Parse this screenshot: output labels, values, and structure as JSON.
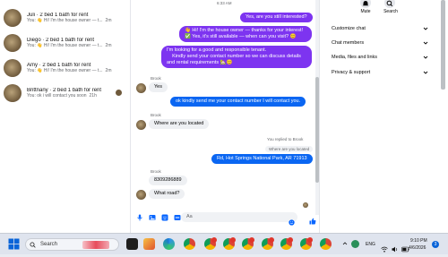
{
  "colors": {
    "purple": "#7d34f0",
    "blue": "#0a66f2",
    "accent": "#0866ff"
  },
  "chat_list": [
    {
      "name": "Juli · 2 bed 1 bath for rent",
      "preview": "You: 👋 Hi! I'm the house owner — t...",
      "time": "2m"
    },
    {
      "name": "Diego · 2 bed 1 bath for rent",
      "preview": "You: 👋 Hi! I'm the house owner — t...",
      "time": "2m"
    },
    {
      "name": "Amy · 2 bed 1 bath for rent",
      "preview": "You: 👋 Hi! I'm the house owner — t...",
      "time": "2m"
    },
    {
      "name": "Brittnany · 2 bed 1 bath for rent",
      "preview": "You: ok i will contact you soon",
      "time": "21h"
    }
  ],
  "conversation": {
    "timestamp": "6:33 AM",
    "msg1": "Yes, are you still interested?",
    "msg2a": "👋 Hi! I'm the house owner — thanks for your interest!",
    "msg2b": "✅ Yes, it's still available — when can you visit? 😊",
    "msg3a": "I'm looking for a good and responsible tenant.",
    "msg3b": "Kindly send your contact number so we can discuss details",
    "msg3c": "and rental requirements 🏡😊",
    "sender1": "Brook",
    "in1": "Yes",
    "out_blue1": "ok kindly send me your contact number I will contact you.",
    "sender2": "Brook",
    "in2": "Where are you located",
    "replied_label": "You replied to Brook",
    "replied_quote": "Where are you located",
    "out_blue2": "Rd, Hot Springs National Park, AR 71913",
    "sender3": "Brook",
    "in3": "8309286889",
    "in4": "What road?",
    "composer_placeholder": "Aa"
  },
  "right_panel": {
    "mute_label": "Mute",
    "search_label": "Search",
    "items": [
      "Customize chat",
      "Chat members",
      "Media, files and links",
      "Privacy & support"
    ]
  },
  "taskbar": {
    "search_placeholder": "Search",
    "lang": "ENG",
    "time": "9:10 PM",
    "date": "4/6/2026",
    "notif_count": "3"
  }
}
